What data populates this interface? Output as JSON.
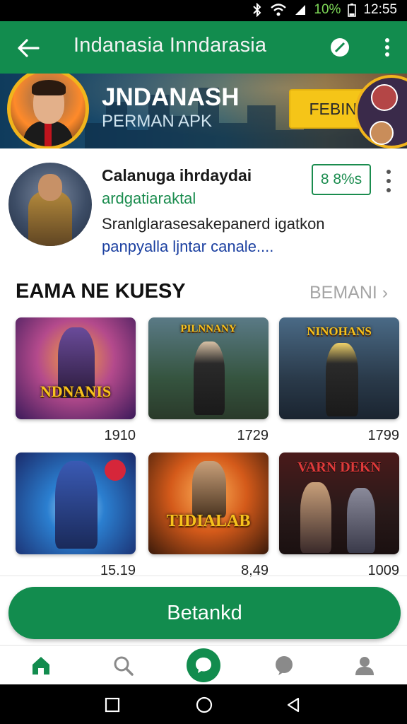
{
  "status": {
    "battery": "10%",
    "time": "12:55"
  },
  "appbar": {
    "title": "Indanasia Inndarasia"
  },
  "banner": {
    "title": "JNDANASH",
    "subtitle": "PERMAN APK",
    "button": "FEBINY"
  },
  "profile": {
    "name": "Calanuga ihrdaydai",
    "handle": "ardgatiaraktal",
    "desc_line1": "Sranlglarasesakepanerd igatkon",
    "desc_line2": "panpyalla ljntar canale....",
    "price": "8 8%s"
  },
  "section": {
    "title": "EAMA NE KUESY",
    "link": "BEMANI"
  },
  "games": [
    {
      "label": "NDNANIS",
      "score": "1910"
    },
    {
      "label": "PILNNANY",
      "score": "1729"
    },
    {
      "label": "NINOHANS",
      "score": "1799"
    },
    {
      "label": "",
      "score": "15.19"
    },
    {
      "label": "TIDIALAB",
      "score": "8,49"
    },
    {
      "label": "VARN DEKN",
      "score": "1009"
    }
  ],
  "cta": {
    "label": "Betankd"
  },
  "bottomnav": {
    "items": [
      "home",
      "search",
      "chat",
      "messages",
      "profile"
    ]
  }
}
